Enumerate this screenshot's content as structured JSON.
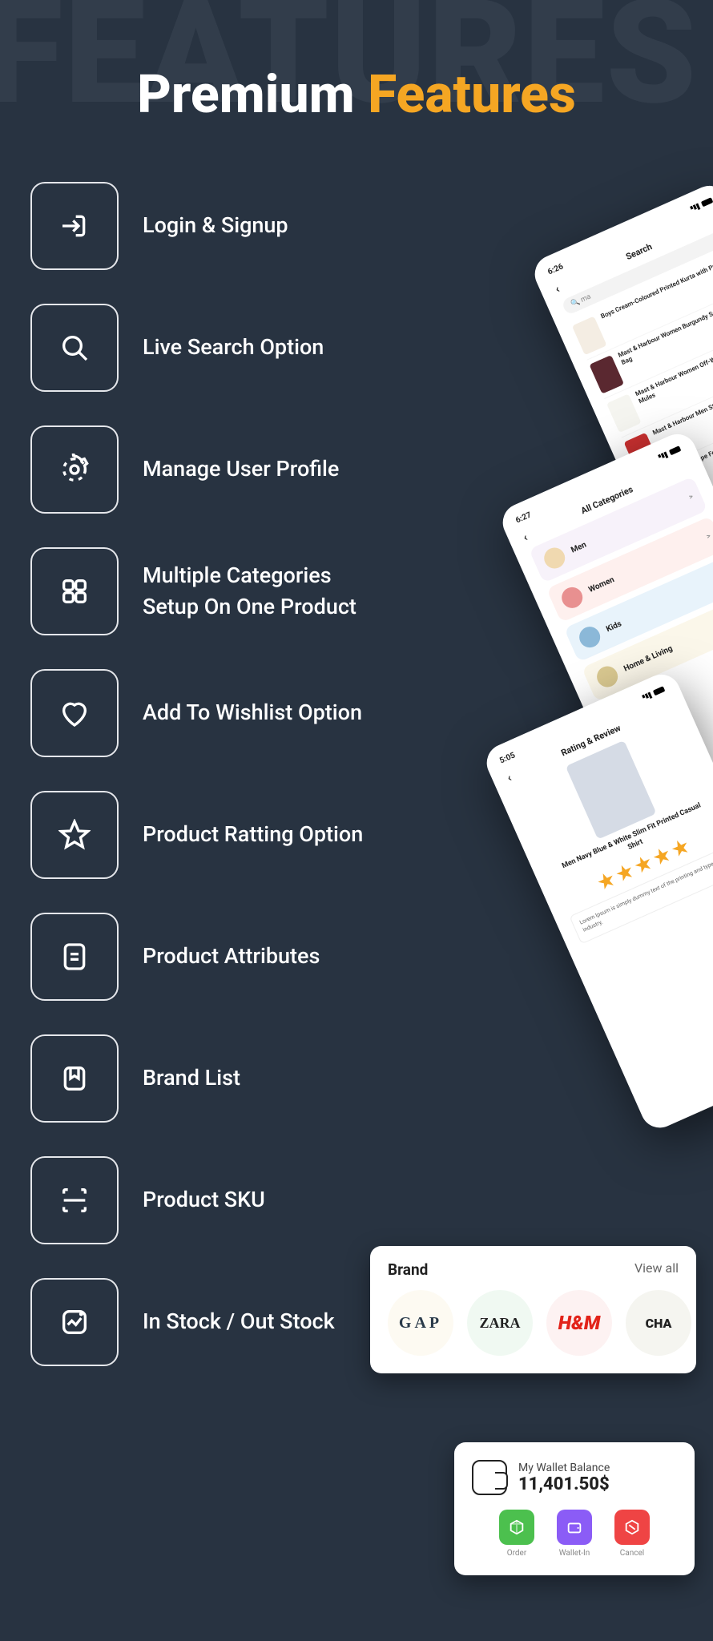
{
  "bg_text": "FEATURES",
  "title": {
    "part1": "Premium ",
    "part2": "Features"
  },
  "features": [
    {
      "icon": "login-icon",
      "label": "Login & Signup"
    },
    {
      "icon": "search-icon",
      "label": "Live Search Option"
    },
    {
      "icon": "gear-icon",
      "label": "Manage User Profile"
    },
    {
      "icon": "grid-icon",
      "label": "Multiple Categories Setup On One Product"
    },
    {
      "icon": "heart-icon",
      "label": "Add To Wishlist Option"
    },
    {
      "icon": "star-icon",
      "label": "Product Ratting Option"
    },
    {
      "icon": "document-icon",
      "label": "Product Attributes"
    },
    {
      "icon": "bookmark-icon",
      "label": "Brand List"
    },
    {
      "icon": "sku-icon",
      "label": "Product SKU"
    },
    {
      "icon": "stock-icon",
      "label": "In Stock / Out Stock"
    }
  ],
  "mockup_search": {
    "time": "6:26",
    "title": "Search",
    "query": "ma",
    "items": [
      "Boys Cream-Coloured Printed Kurta with Pyjamas",
      "Mast & Harbour Women Burgundy Solid Handheld Bag",
      "Mast & Harbour Women Off-White Solid Heeled Mules",
      "Mast & Harbour Men Striped Sliders",
      "Louis Philippe Formal"
    ]
  },
  "mockup_categories": {
    "time": "6:27",
    "title": "All Categories",
    "items": [
      "Men",
      "Women",
      "Kids",
      "Home & Living"
    ]
  },
  "mockup_review": {
    "time": "5:05",
    "title": "Rating & Review",
    "product": "Men Navy Blue & White Slim Fit Printed Casual Shirt",
    "text": "Lorem Ipsum is simply dummy text of the printing and typesetting industry."
  },
  "brand_card": {
    "title": "Brand",
    "view_all": "View all",
    "brands": [
      "GAP",
      "ZARA",
      "H&M",
      "CHA"
    ]
  },
  "wallet_card": {
    "label": "My Wallet Balance",
    "amount": "11,401.50$",
    "actions": [
      {
        "label": "Order",
        "color": "#4cc04e"
      },
      {
        "label": "Wallet-In",
        "color": "#8b5cf6"
      },
      {
        "label": "Cancel",
        "color": "#ef4444"
      }
    ]
  }
}
